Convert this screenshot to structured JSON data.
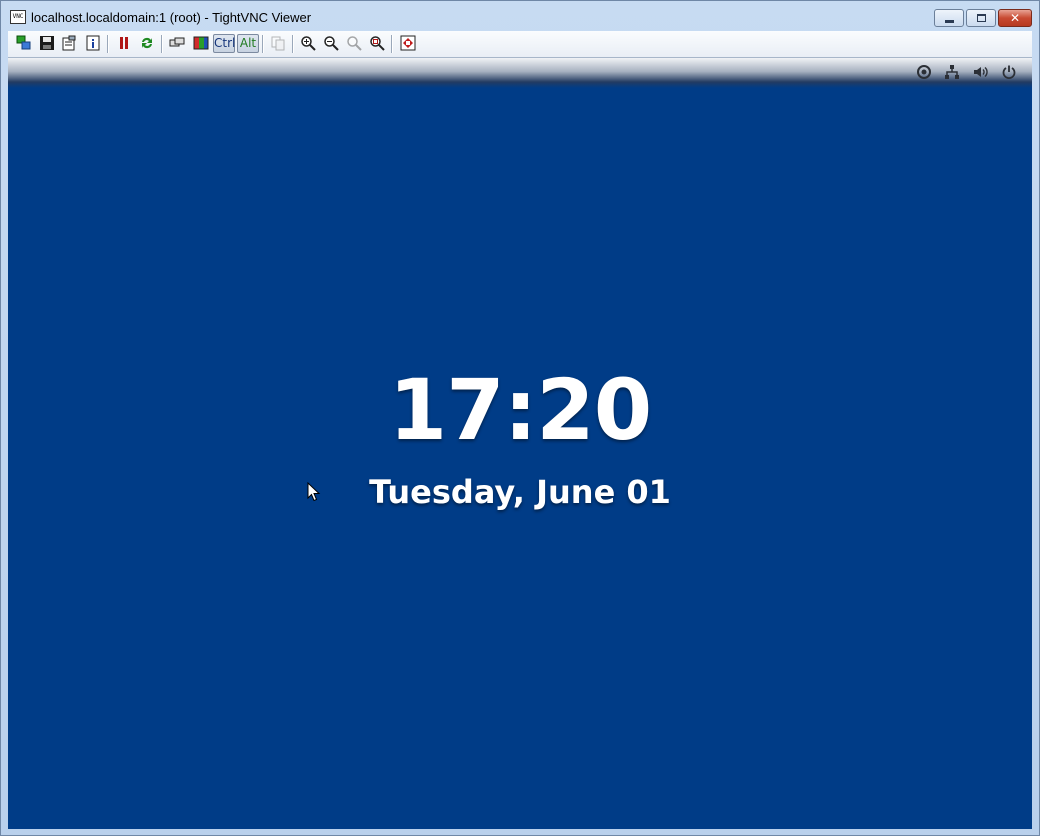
{
  "window": {
    "title": "localhost.localdomain:1 (root) - TightVNC Viewer",
    "app_icon_text": "VNC",
    "caption_buttons": {
      "minimize": "minimize",
      "maximize": "maximize",
      "close": "✕"
    }
  },
  "toolbar": {
    "ctrl_label": "Ctrl",
    "alt_label": "Alt",
    "buttons": [
      {
        "icon": "new-connection-icon"
      },
      {
        "icon": "save-icon"
      },
      {
        "icon": "options-icon"
      },
      {
        "icon": "connection-info-icon"
      },
      {
        "icon": "pause-icon"
      },
      {
        "icon": "refresh-icon"
      },
      {
        "icon": "ctrl-alt-del-icon"
      },
      {
        "icon": "ctrl-esc-icon"
      },
      {
        "icon": "transfer-files-icon"
      },
      {
        "icon": "zoom-in-icon"
      },
      {
        "icon": "zoom-out-icon"
      },
      {
        "icon": "zoom-100-icon"
      },
      {
        "icon": "zoom-auto-icon"
      },
      {
        "icon": "fullscreen-icon"
      }
    ]
  },
  "remote": {
    "background_color": "#003c87",
    "time": "17:20",
    "date": "Tuesday, June 01",
    "status_icons": [
      "accessibility-icon",
      "network-icon",
      "volume-icon",
      "power-icon"
    ]
  }
}
